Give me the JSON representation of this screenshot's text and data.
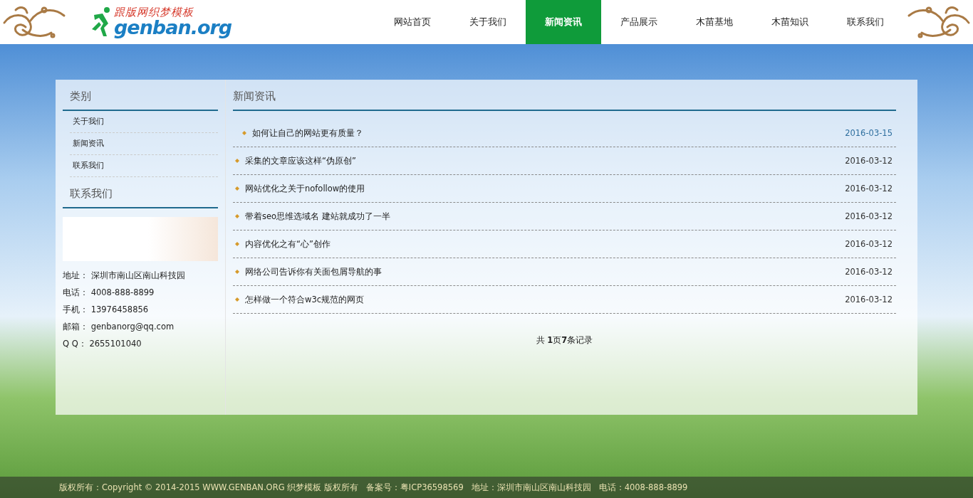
{
  "logo": {
    "chinese": "跟版网织梦模板",
    "latin": "genban.org"
  },
  "nav": [
    {
      "label": "网站首页",
      "selected": false
    },
    {
      "label": "关于我们",
      "selected": false
    },
    {
      "label": "新闻资讯",
      "selected": true
    },
    {
      "label": "产品展示",
      "selected": false
    },
    {
      "label": "木苗基地",
      "selected": false
    },
    {
      "label": "木苗知识",
      "selected": false
    },
    {
      "label": "联系我们",
      "selected": false
    }
  ],
  "sidebar": {
    "category_title": "类别",
    "categories": [
      "关于我们",
      "新闻资讯",
      "联系我们"
    ],
    "contact_title": "联系我们",
    "contact_lines": [
      {
        "label": "地址：",
        "value": "深圳市南山区南山科技园"
      },
      {
        "label": "电话：",
        "value": "4008-888-8899"
      },
      {
        "label": "手机：",
        "value": "13976458856"
      },
      {
        "label": "邮箱：",
        "value": "genbanorg@qq.com"
      },
      {
        "label": "Q Q：",
        "value": "2655101040"
      }
    ]
  },
  "news": {
    "title": "新闻资讯",
    "items": [
      {
        "title": "如何让自己的网站更有质量？",
        "date": "2016-03-15",
        "highlighted": true
      },
      {
        "title": "采集的文章应该这样“伪原创”",
        "date": "2016-03-12",
        "highlighted": false
      },
      {
        "title": "网站优化之关于nofollow的使用",
        "date": "2016-03-12",
        "highlighted": false
      },
      {
        "title": "带着seo思维选域名 建站就成功了一半",
        "date": "2016-03-12",
        "highlighted": false
      },
      {
        "title": "内容优化之有“心”创作",
        "date": "2016-03-12",
        "highlighted": false
      },
      {
        "title": "网络公司告诉你有关面包屑导航的事",
        "date": "2016-03-12",
        "highlighted": false
      },
      {
        "title": "怎样做一个符合w3c规范的网页",
        "date": "2016-03-12",
        "highlighted": false
      }
    ],
    "pagination": "共 **1**页**7**条记录"
  },
  "footer": "版权所有：Copyright © 2014-2015 WWW.GENBAN.ORG 织梦模板 版权所有   备案号：粤ICP36598569   地址：深圳市南山区南山科技园   电话：4008-888-8899"
}
